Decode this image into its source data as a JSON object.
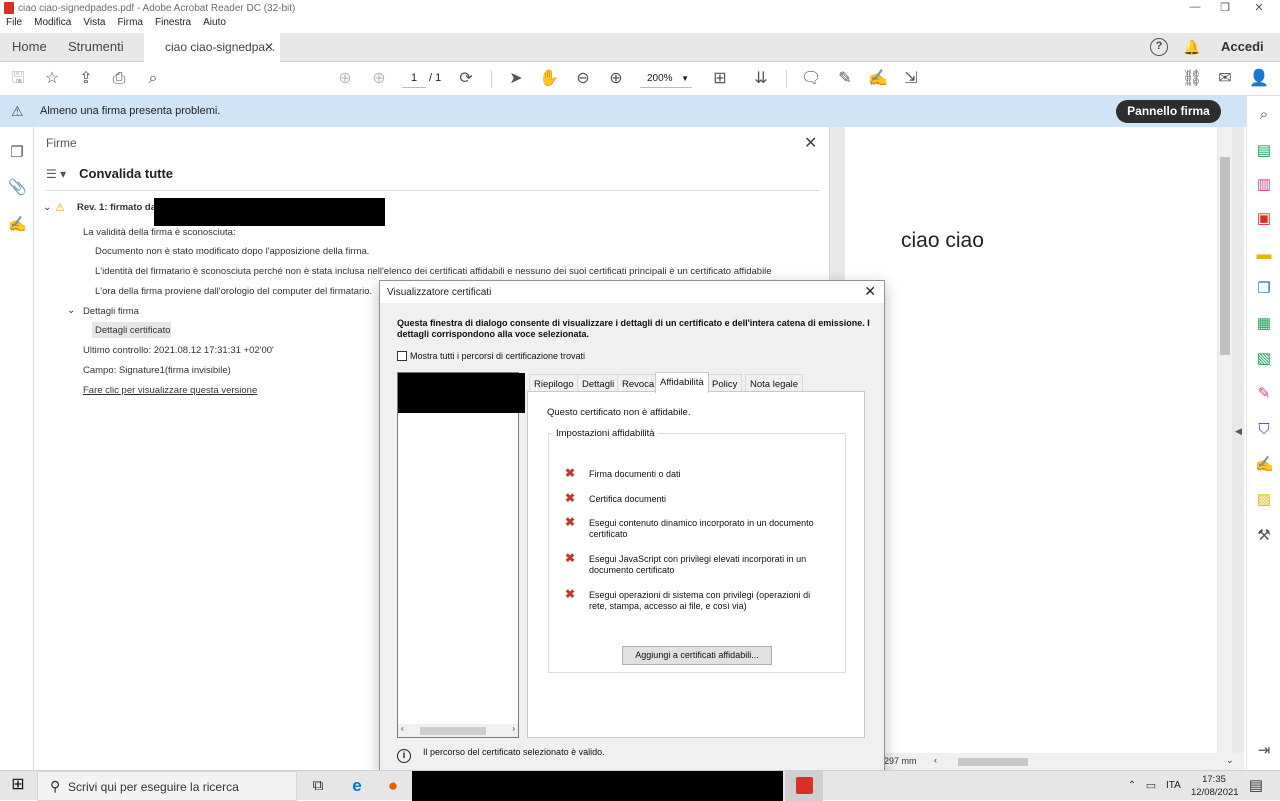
{
  "window": {
    "title": "ciao ciao-signedpades.pdf - Adobe Acrobat Reader DC (32-bit)"
  },
  "menu": [
    "File",
    "Modifica",
    "Vista",
    "Firma",
    "Finestra",
    "Aiuto"
  ],
  "tabs": {
    "home": "Home",
    "tools": "Strumenti",
    "document": "ciao ciao-signedpa...",
    "signin": "Accedi"
  },
  "toolbar": {
    "page_current": "1",
    "page_total": "/ 1",
    "zoom": "200%"
  },
  "notification": {
    "message": "Almeno una firma presenta problemi.",
    "button": "Pannello firma"
  },
  "signatures_panel": {
    "header": "Firme",
    "validate_all": "Convalida tutte",
    "revision": "Rev. 1: firmato da",
    "validity": "La validità della firma è sconosciuta:",
    "details": [
      "Documento non è stato modificato dopo l'apposizione della firma.",
      "L'identità del firmatario è sconosciuta perché non è stata inclusa nell'elenco dei certificati affidabili e nessuno dei suoi certificati principali è un certificato affidabile",
      "L'ora della firma proviene dall'orologio del computer del firmatario."
    ],
    "sig_details": "Dettagli firma",
    "cert_details": "Dettagli certificato",
    "last_check": "Ultimo controllo: 2021.08.12 17:31:31 +02'00'",
    "field": "Campo: Signature1(firma invisibile)",
    "view_version": "Fare clic per visualizzare questa versione"
  },
  "document": {
    "text": "ciao ciao",
    "page_size": "297 mm"
  },
  "dialog": {
    "title": "Visualizzatore certificati",
    "intro": "Questa finestra di dialogo consente di visualizzare i dettagli di un certificato e dell'intera catena di emissione. I dettagli corrispondono alla voce selezionata.",
    "show_all_paths": "Mostra tutti i percorsi di certificazione trovati",
    "tabs": [
      "Riepilogo",
      "Dettagli",
      "Revoca",
      "Affidabilità",
      "Policy",
      "Nota legale"
    ],
    "active_tab": 3,
    "not_trusted": "Questo certificato non è affidabile.",
    "trust_group": "Impostazioni affidabilità",
    "permissions": [
      "Firma documenti o dati",
      "Certifica documenti",
      "Esegui contenuto dinamico incorporato in un documento certificato",
      "Esegui JavaScript con privilegi elevati incorporati in un documento certificato",
      "Esegui operazioni di sistema con privilegi (operazioni di rete, stampa, accesso ai file, e così via)"
    ],
    "add_trusted": "Aggiungi a certificati affidabili...",
    "footer": "Il percorso del certificato selezionato è valido."
  },
  "taskbar": {
    "search_placeholder": "Scrivi qui per eseguire la ricerca",
    "lang": "ITA",
    "time": "17:35",
    "date": "12/08/2021"
  },
  "colors": {
    "notification_bg": "#cfe4f7",
    "error_red": "#c0392b",
    "accent_dark": "#2d2d2d"
  },
  "icons": [
    "pdf-icon",
    "save-icon",
    "star-icon",
    "upload-icon",
    "print-icon",
    "search-icon",
    "page-up-icon",
    "page-down-icon",
    "rotate-icon",
    "pointer-icon",
    "hand-icon",
    "zoom-out-icon",
    "zoom-in-icon",
    "fit-page-icon",
    "scroll-icon",
    "comment-icon",
    "highlight-icon",
    "sign-icon",
    "fill-sign-icon",
    "share-link-icon",
    "mail-icon",
    "add-user-icon",
    "help-icon",
    "bell-icon",
    "warning-icon",
    "pages-icon",
    "attachment-icon",
    "signature-panel-icon",
    "x-icon",
    "info-icon",
    "windows-icon"
  ]
}
